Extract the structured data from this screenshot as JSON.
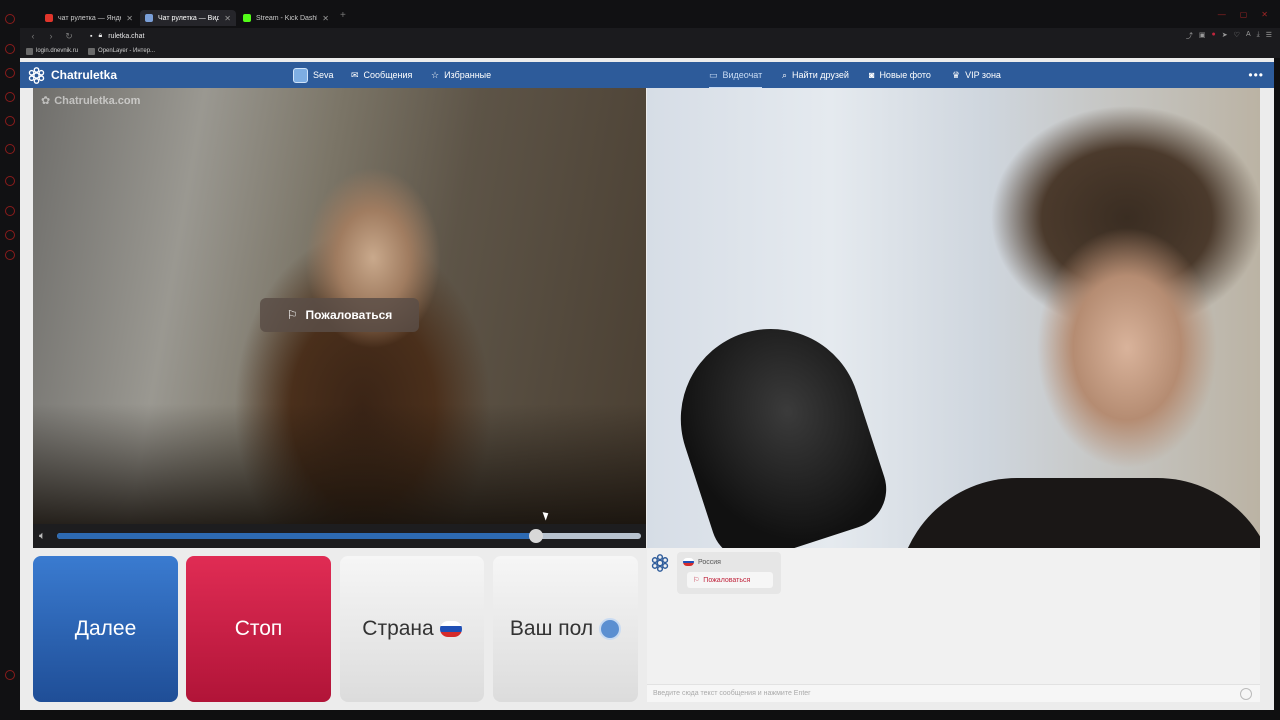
{
  "browser": {
    "tabs": [
      {
        "title": "чат рулетка — Яндекс: на",
        "active": false
      },
      {
        "title": "Чат рулетка — Видео",
        "active": true
      },
      {
        "title": "Stream - Kick Dashboard",
        "active": false
      }
    ],
    "url": "ruletka.chat",
    "bookmarks": [
      "login.dnevnik.ru",
      "OpenLayer - Интер..."
    ]
  },
  "site": {
    "logo": "Chatruletka",
    "user_name": "Seva",
    "nav_left": [
      {
        "label": "Сообщения",
        "icon": "envelope-icon"
      },
      {
        "label": "Избранные",
        "icon": "star-icon"
      }
    ],
    "nav_right": [
      {
        "label": "Видеочат",
        "icon": "video-icon",
        "active": true
      },
      {
        "label": "Найти друзей",
        "icon": "search-icon"
      },
      {
        "label": "Новые фото",
        "icon": "camera-icon"
      },
      {
        "label": "VIP зона",
        "icon": "crown-icon"
      }
    ]
  },
  "video": {
    "watermark": "Chatruletka.com",
    "report_label": "Пожаловаться",
    "volume": 0.82
  },
  "actions": {
    "next": "Далее",
    "stop": "Стоп",
    "country": "Страна",
    "gender": "Ваш пол"
  },
  "chat": {
    "partner_country": "Россия",
    "report_label": "Пожаловаться",
    "input_placeholder": "Введите сюда текст сообщения и нажмите Enter"
  },
  "colors": {
    "nav_blue": "#2d5b9a",
    "next_blue": "#2a62b5",
    "stop_red": "#cf1f48"
  }
}
